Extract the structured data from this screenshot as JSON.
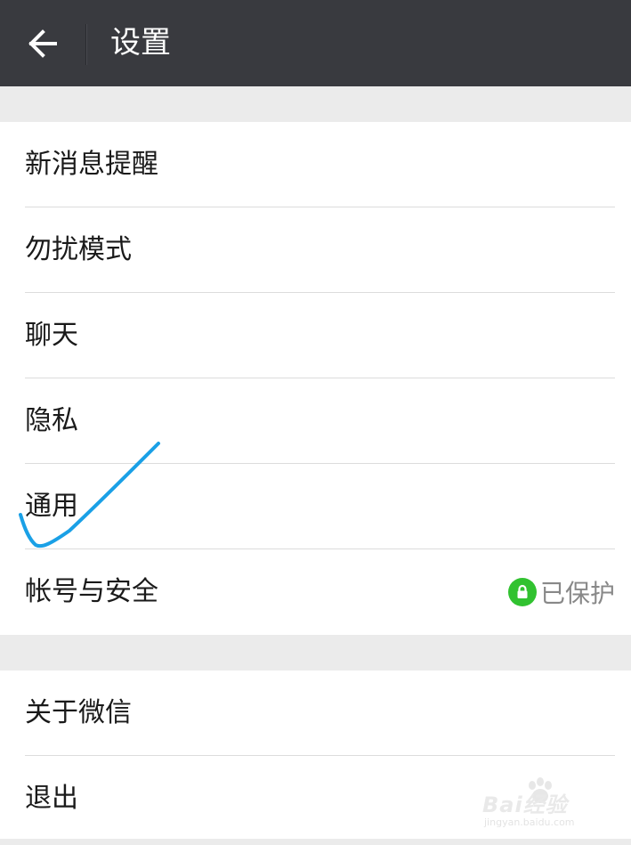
{
  "header": {
    "title": "设置",
    "back_icon": "arrow-left-icon",
    "background_color": "#393a3f"
  },
  "settings": {
    "items": [
      {
        "label": "新消息提醒"
      },
      {
        "label": "勿扰模式"
      },
      {
        "label": "聊天"
      },
      {
        "label": "隐私"
      },
      {
        "label": "通用"
      },
      {
        "label": "帐号与安全",
        "status": "已保护",
        "status_icon": "lock-icon"
      }
    ]
  },
  "bottom": {
    "items": [
      {
        "label": "关于微信"
      },
      {
        "label": "退出"
      }
    ]
  },
  "annotation": {
    "icon": "hand-drawn-checkmark",
    "color": "#1aa0e6"
  },
  "watermark": {
    "logo": "Bai经验",
    "url": "jingyan.baidu.com"
  },
  "colors": {
    "accent_green": "#31c230",
    "page_background": "#ebebeb"
  }
}
